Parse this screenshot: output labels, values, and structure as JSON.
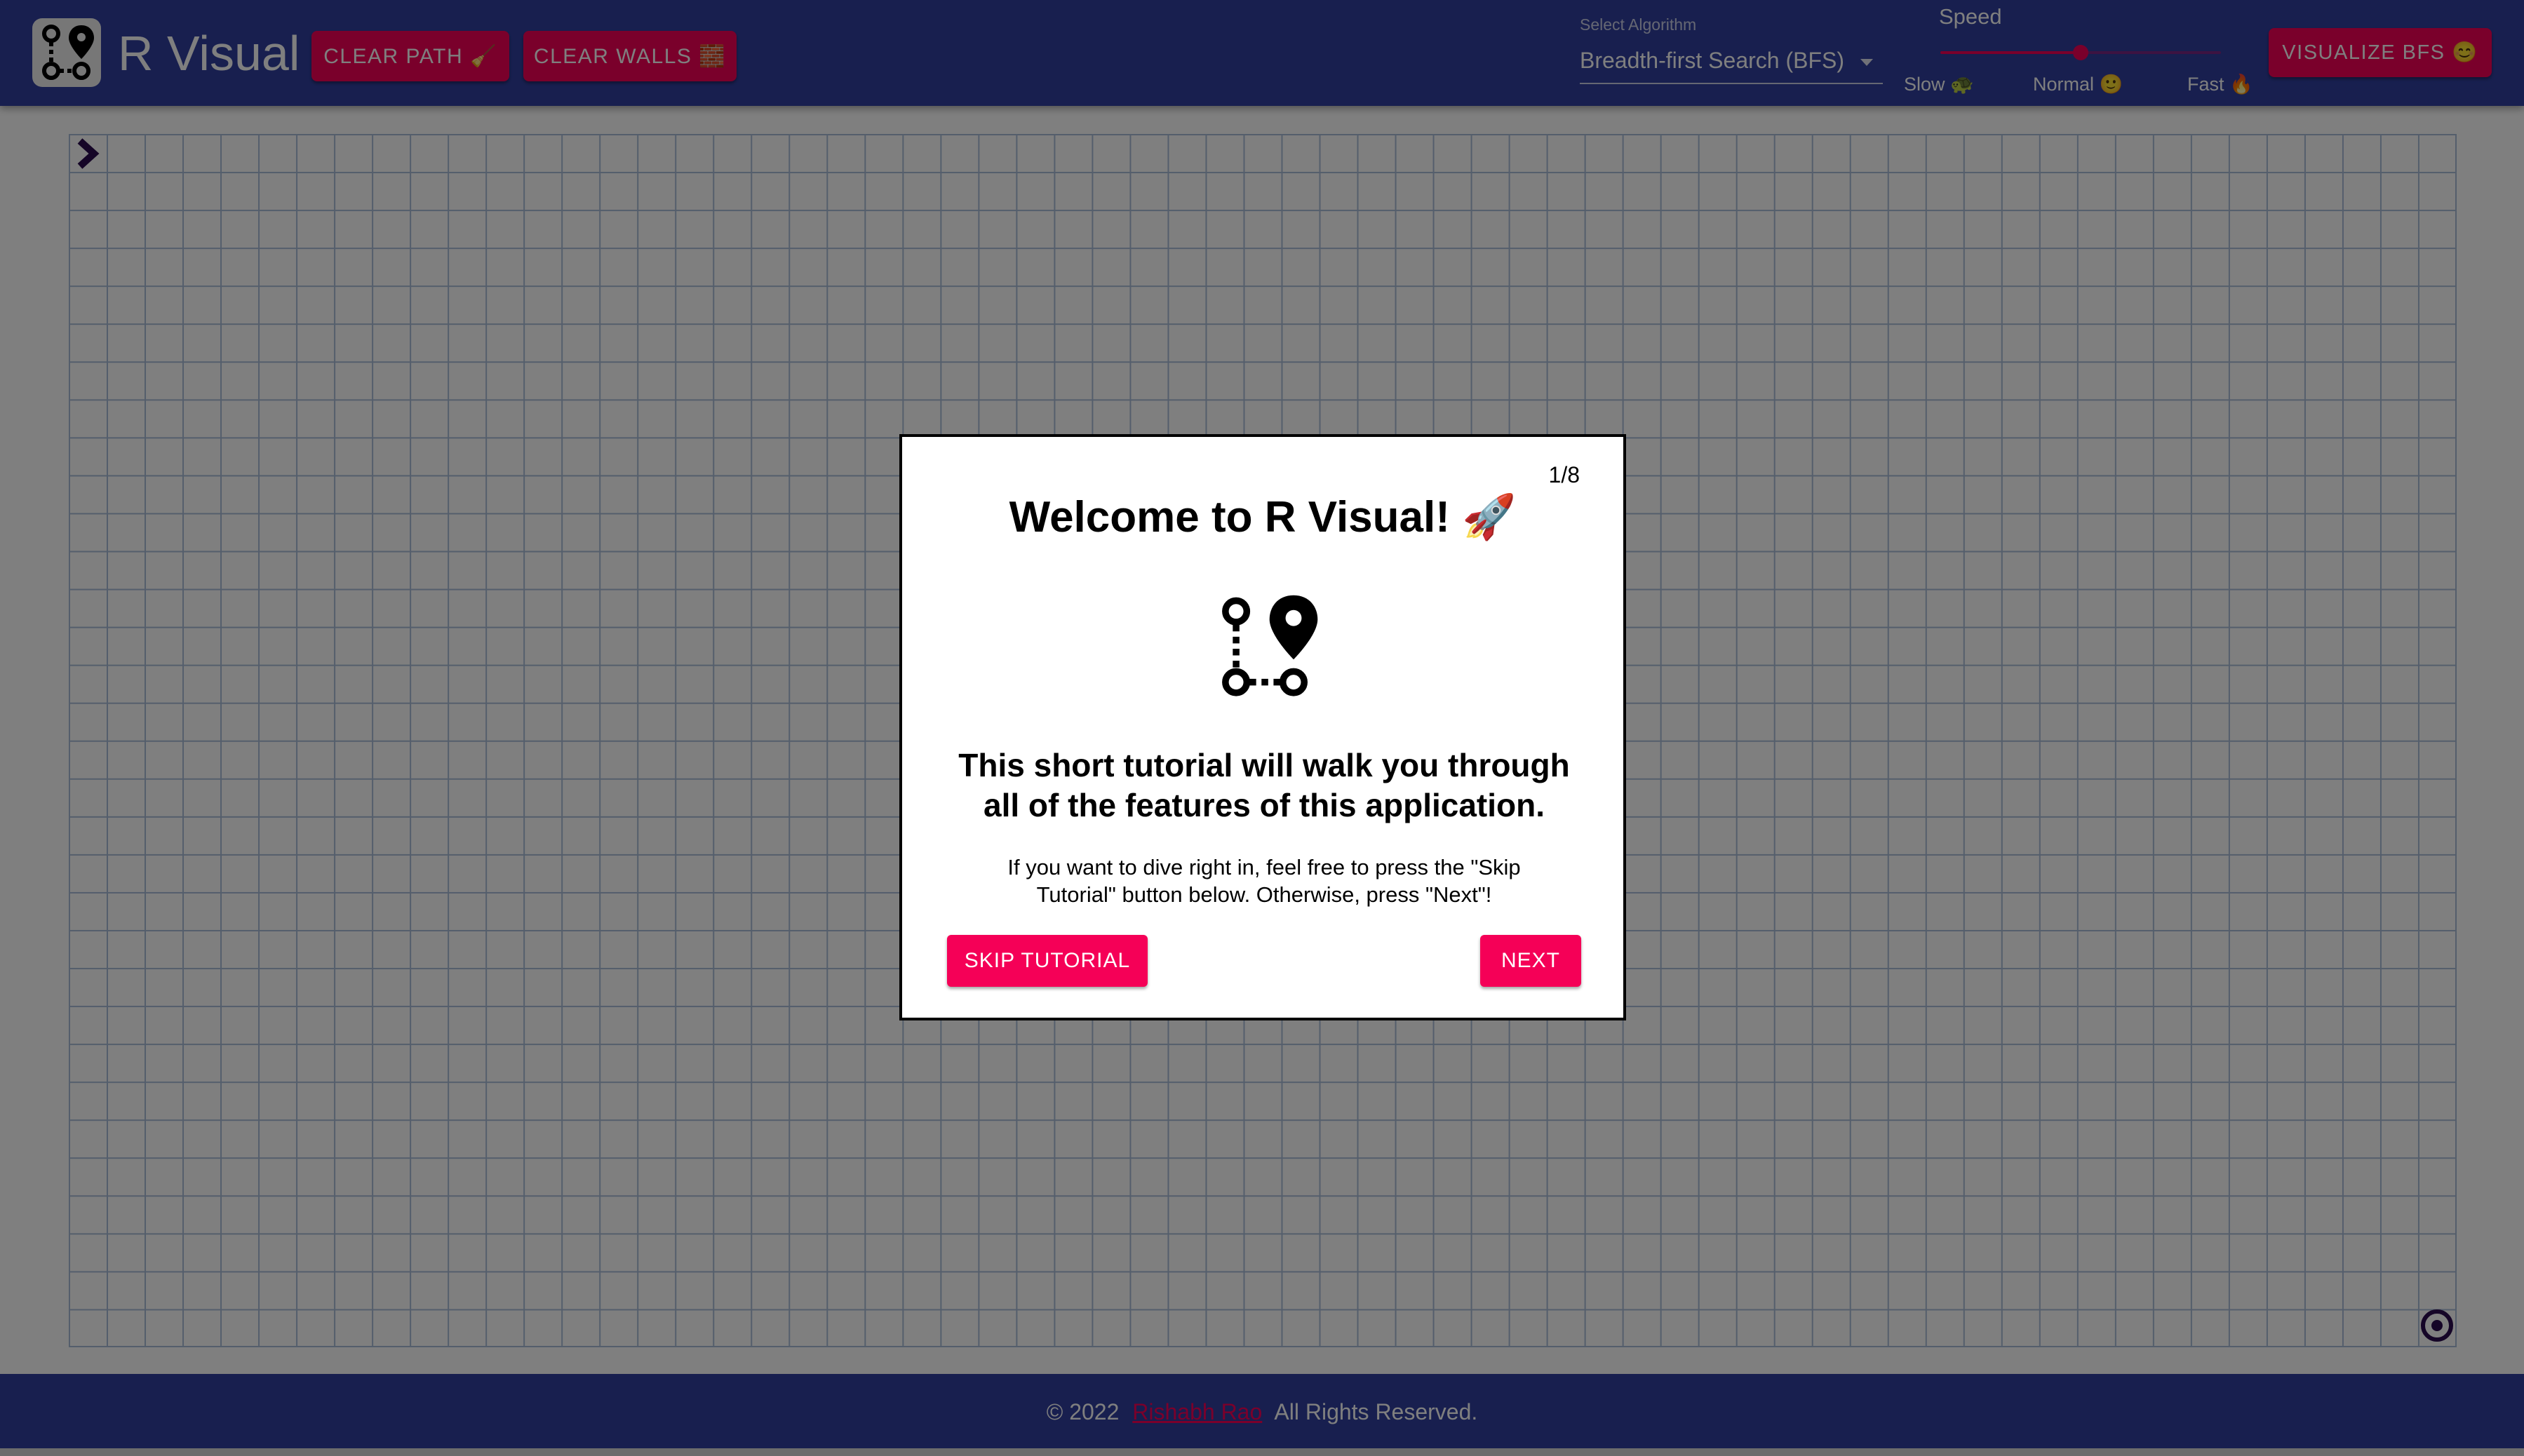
{
  "header": {
    "app_title": "R Visual",
    "clear_path_label": "CLEAR PATH 🧹",
    "clear_walls_label": "CLEAR WALLS 🧱",
    "algorithm": {
      "label": "Select Algorithm",
      "selected": "Breadth-first Search (BFS)"
    },
    "speed": {
      "label": "Speed",
      "value_fraction": 0.5,
      "marks": {
        "slow": "Slow 🐢",
        "normal": "Normal 🙂",
        "fast": "Fast 🔥"
      }
    },
    "visualize_label": "VISUALIZE BFS 😊"
  },
  "grid": {
    "start_icon": "chevron-right-icon",
    "target_icon": "target-icon"
  },
  "modal": {
    "counter": "1/8",
    "title": "Welcome to R Visual! 🚀",
    "heading": "This short tutorial will walk you through all of the features of this application.",
    "body": "If you want to dive right in, feel free to press the \"Skip Tutorial\" button below. Otherwise, press \"Next\"!",
    "skip_label": "SKIP TUTORIAL",
    "next_label": "NEXT",
    "icon": "route-icon"
  },
  "footer": {
    "prefix": "© 2022",
    "author": "Rishabh Rao",
    "suffix": "All Rights Reserved."
  },
  "colors": {
    "primary": "#303f9f",
    "accent": "#f50057",
    "grid_line": "#a9bdd9",
    "node": "#2b0b4e"
  }
}
